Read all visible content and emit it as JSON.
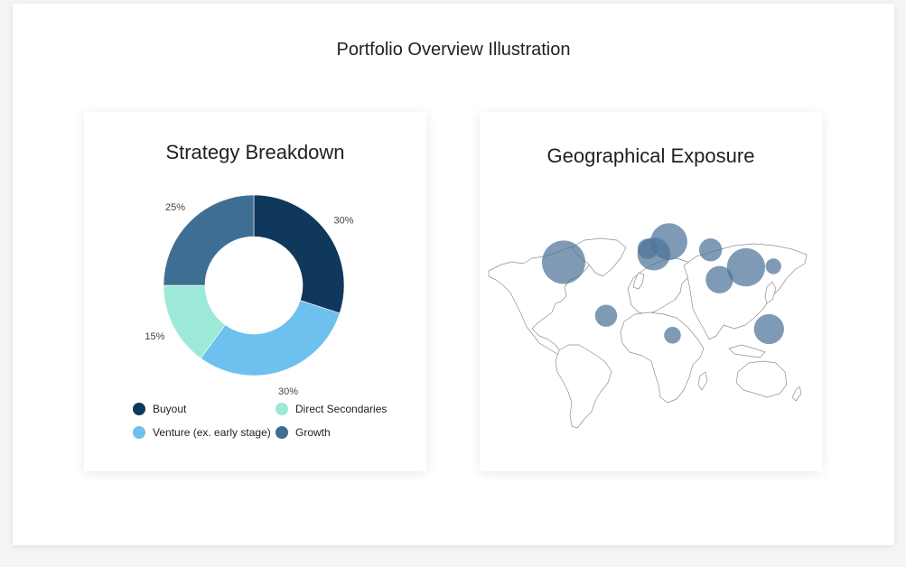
{
  "page": {
    "title": "Portfolio Overview Illustration"
  },
  "strategy_card": {
    "title": "Strategy Breakdown"
  },
  "geo_card": {
    "title": "Geographical Exposure"
  },
  "chart_data": [
    {
      "type": "pie",
      "variant": "donut",
      "title": "Strategy Breakdown",
      "slices": [
        {
          "name": "Buyout",
          "value": 30,
          "label": "30%",
          "color": "#10375c"
        },
        {
          "name": "Venture (ex. early stage)",
          "value": 30,
          "label": "30%",
          "color": "#6ec0ee"
        },
        {
          "name": "Direct Secondaries",
          "value": 15,
          "label": "15%",
          "color": "#9de9d7"
        },
        {
          "name": "Growth",
          "value": 25,
          "label": "25%",
          "color": "#3e6e94"
        }
      ],
      "legend_order": [
        "Buyout",
        "Direct Secondaries",
        "Venture (ex. early stage)",
        "Growth"
      ],
      "legend_placement": "bottom"
    },
    {
      "type": "scatter",
      "variant": "bubble-map",
      "title": "Geographical Exposure",
      "bubble_color": "#4d7399",
      "points": [
        {
          "region": "North America",
          "lon": -98,
          "lat": 40,
          "size": 1.0
        },
        {
          "region": "South America",
          "lon": -50,
          "lat": -12,
          "size": 0.26
        },
        {
          "region": "Southern Africa",
          "lon": 25,
          "lat": -31,
          "size": 0.15
        },
        {
          "region": "Western Europe",
          "lon": 4,
          "lat": 48,
          "size": 0.58
        },
        {
          "region": "UK",
          "lon": -3,
          "lat": 53,
          "size": 0.22
        },
        {
          "region": "Northern Europe",
          "lon": 21,
          "lat": 60,
          "size": 0.72
        },
        {
          "region": "Central Asia",
          "lon": 68,
          "lat": 52,
          "size": 0.28
        },
        {
          "region": "India",
          "lon": 78,
          "lat": 23,
          "size": 0.4
        },
        {
          "region": "China",
          "lon": 108,
          "lat": 35,
          "size": 0.78
        },
        {
          "region": "Japan",
          "lon": 139,
          "lat": 36,
          "size": 0.13
        },
        {
          "region": "Australia",
          "lon": 134,
          "lat": -25,
          "size": 0.48
        }
      ]
    }
  ]
}
